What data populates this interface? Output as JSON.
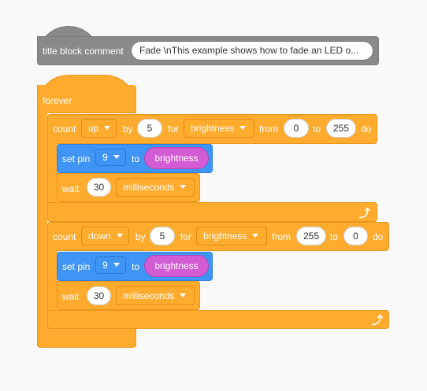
{
  "hat": {
    "label": "title block comment",
    "comment": "Fade \\nThis example shows how to fade an LED o..."
  },
  "forever": {
    "label": "forever"
  },
  "count_up": {
    "count": "count",
    "direction": "up",
    "by": "by",
    "step": "5",
    "for": "for",
    "var": "brightness",
    "from": "from",
    "start": "0",
    "to": "to",
    "end": "255",
    "do": "do"
  },
  "set_pin_1": {
    "label": "set pin",
    "pin": "9",
    "to": "to",
    "value": "brightness"
  },
  "wait_1": {
    "label": "wait",
    "amount": "30",
    "unit": "milliseconds"
  },
  "count_down": {
    "count": "count",
    "direction": "down",
    "by": "by",
    "step": "5",
    "for": "for",
    "var": "brightness",
    "from": "from",
    "start": "255",
    "to": "to",
    "end": "0",
    "do": "do"
  },
  "set_pin_2": {
    "label": "set pin",
    "pin": "9",
    "to": "to",
    "value": "brightness"
  },
  "wait_2": {
    "label": "wait",
    "amount": "30",
    "unit": "milliseconds"
  },
  "icons": {
    "loop": "loop-arrow-icon",
    "caret": "caret-down-icon"
  },
  "colors": {
    "control": "#ffab2e",
    "comment": "#8a8a8a",
    "pin": "#3f95f5",
    "variable": "#d35bd3"
  }
}
